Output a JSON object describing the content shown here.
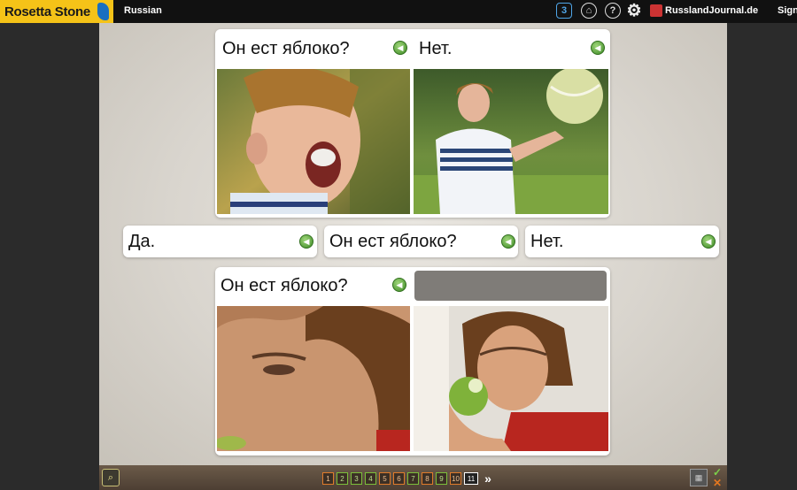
{
  "topbar": {
    "brand": "Rosetta Stone",
    "language": "Russian",
    "level_badge": "3",
    "site": "RusslandJournal.de",
    "sign": "Sign"
  },
  "top_card": {
    "left_phrase": "Он ест яблоко?",
    "right_phrase": "Нет."
  },
  "choices": [
    {
      "label": "Да."
    },
    {
      "label": "Он ест яблоко?"
    },
    {
      "label": "Нет."
    }
  ],
  "bottom_card": {
    "left_phrase": "Он ест яблоко?"
  },
  "pager": {
    "pages": [
      "1",
      "2",
      "3",
      "4",
      "5",
      "6",
      "7",
      "8",
      "9",
      "10",
      "11"
    ],
    "current": "11",
    "next_symbol": "»"
  },
  "icons": {
    "speaker": "speaker-icon",
    "home": "home-icon",
    "help": "help-icon",
    "settings": "gear-icon",
    "zoom": "zoom-icon",
    "grid": "grid-icon",
    "check": "check-icon",
    "cross": "cross-icon"
  },
  "colors": {
    "brand_yellow": "#f5c318",
    "speaker_green": "#3d8a25",
    "answer_slot": "#7f7c78",
    "page_done": "#7bbf3a",
    "page_pending": "#e07b2a"
  }
}
